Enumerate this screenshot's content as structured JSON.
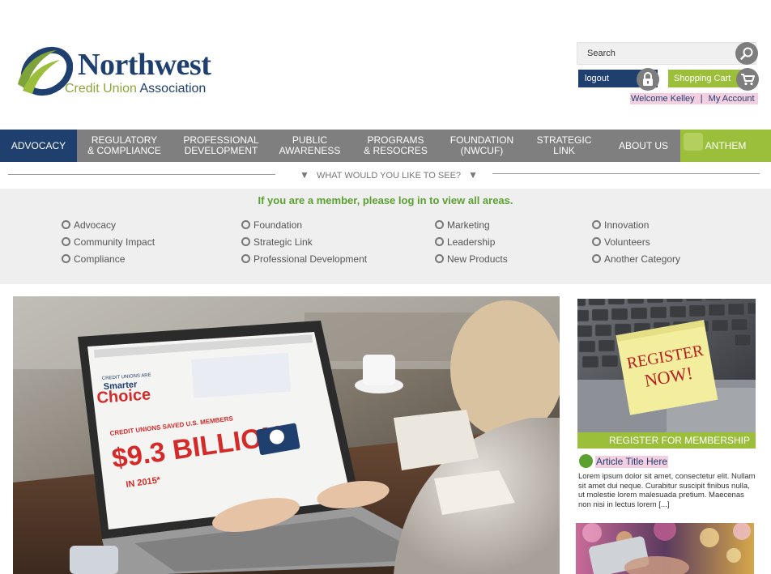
{
  "brand": {
    "name": "Northwest",
    "sub_prefix": "Credit Union",
    "sub_suffix": "Association"
  },
  "header": {
    "search_placeholder": "Search",
    "logout_label": "logout",
    "cart_label": "Shopping Cart",
    "welcome": "Welcome Kelley",
    "separator": "|",
    "account_label": "My Account"
  },
  "nav": {
    "items": [
      {
        "line1": "ADVOCACY",
        "line2": ""
      },
      {
        "line1": "REGULATORY",
        "line2": "& COMPLIANCE"
      },
      {
        "line1": "PROFESSIONAL",
        "line2": "DEVELOPMENT"
      },
      {
        "line1": "PUBLIC",
        "line2": "AWARENESS"
      },
      {
        "line1": "PROGRAMS",
        "line2": "& RESOCRES"
      },
      {
        "line1": "FOUNDATION",
        "line2": "(NWCUF)"
      },
      {
        "line1": "STRATEGIC",
        "line2": "LINK"
      },
      {
        "line1": "ABOUT US",
        "line2": ""
      },
      {
        "line1": "ANTHEM",
        "line2": ""
      }
    ]
  },
  "explore": {
    "question": "WHAT WOULD YOU LIKE TO SEE?",
    "member_message": "If you are a member, please log in to view all areas.",
    "columns": [
      [
        "Advocacy",
        "Community Impact",
        "Compliance"
      ],
      [
        "Foundation",
        "Strategic Link",
        "Professional Development"
      ],
      [
        "Marketing",
        "Leadership",
        "New Products"
      ],
      [
        "Innovation",
        "Volunteers",
        "Another Category"
      ]
    ]
  },
  "hero": {
    "laptop_header_line1": "CREDIT UNIONS ARE",
    "laptop_brand1": "Smarter",
    "laptop_brand2": "Choice",
    "laptop_line1": "CREDIT UNIONS SAVED U.S. MEMBERS",
    "laptop_amount": "$9.3 BILLION",
    "laptop_year": "IN 2015*"
  },
  "sidebar": {
    "note_line1": "REGISTER",
    "note_line2": "NOW!",
    "register_label": "REGISTER FOR MEMBERSHIP",
    "article_title": "Article Title Here",
    "article_body": "Lorem ipsum dolor sit amet, consectetur elit. Nullam sit amet dui neque. Curabitur suscipit finibus nulla, ut molestie lorem malesuada pretium. Maecenas non nisi in lectus lorem [...]"
  },
  "colors": {
    "navy": "#1f3f6e",
    "green": "#9bbf3a",
    "nav_gray": "#7f7f7f",
    "highlight_pink": "#f3cfe1"
  }
}
